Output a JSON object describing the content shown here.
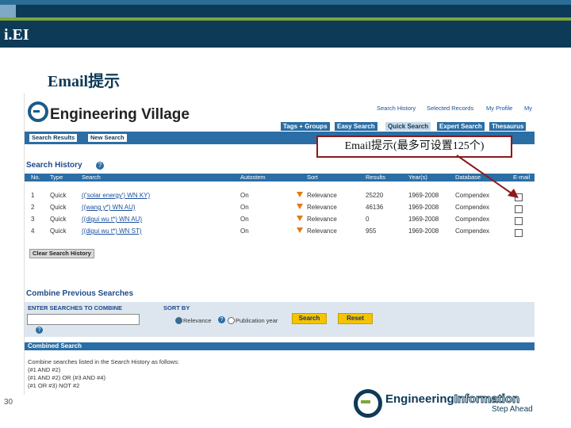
{
  "slide": {
    "title": "i.EI",
    "subtitle": "Email提示",
    "callout": "Email提示(最多可设置125个)",
    "page_number": "30"
  },
  "app": {
    "name": "Engineering Village",
    "top_links": [
      "Search History",
      "Selected Records",
      "My Profile",
      "My"
    ],
    "tabs": [
      "Tags + Groups",
      "Easy Search",
      "Quick Search",
      "Expert Search",
      "Thesaurus"
    ],
    "active_tab": "Quick Search",
    "nav_buttons": [
      "Search Results",
      "New Search"
    ]
  },
  "history": {
    "title": "Search History",
    "columns": [
      "No.",
      "Type",
      "Search",
      "Autostem",
      "Sort",
      "Results",
      "Year(s)",
      "Database",
      "E-mail"
    ],
    "rows": [
      {
        "no": "1",
        "type": "Quick",
        "search": "(('solar energy') WN KY)",
        "autostem": "On",
        "sort": "Relevance",
        "results": "25220",
        "years": "1969-2008",
        "database": "Compendex"
      },
      {
        "no": "2",
        "type": "Quick",
        "search": "((wang y*) WN AU)",
        "autostem": "On",
        "sort": "Relevance",
        "results": "46136",
        "years": "1969-2008",
        "database": "Compendex"
      },
      {
        "no": "3",
        "type": "Quick",
        "search": "((digui wu t*) WN AU)",
        "autostem": "On",
        "sort": "Relevance",
        "results": "0",
        "years": "1969-2008",
        "database": "Compendex"
      },
      {
        "no": "4",
        "type": "Quick",
        "search": "((digui wu t*) WN ST)",
        "autostem": "On",
        "sort": "Relevance",
        "results": "955",
        "years": "1969-2008",
        "database": "Compendex"
      }
    ],
    "clear_button": "Clear Search History"
  },
  "combine": {
    "title": "Combine Previous Searches",
    "enter_label": "ENTER SEARCHES TO COMBINE",
    "sort_label": "SORT BY",
    "sort_options": [
      "Relevance",
      "Publication year"
    ],
    "search_button": "Search",
    "reset_button": "Reset",
    "help_icon": "?"
  },
  "combined": {
    "title": "Combined Search",
    "lines": [
      "Combine searches listed in the Search History as follows:",
      "(#1 AND #2)",
      "(#1 AND #2) OR (#3 AND #4)",
      "(#1 OR #3) NOT #2"
    ]
  },
  "footer": {
    "brand_a": "Engineering",
    "brand_b": "Information",
    "tagline": "Step Ahead"
  },
  "colors": {
    "navy": "#0d3a57",
    "green_accent": "#7da53b",
    "app_blue": "#2a6ea5",
    "callout_border": "#8b1a1a",
    "button_yellow": "#f5c400"
  }
}
